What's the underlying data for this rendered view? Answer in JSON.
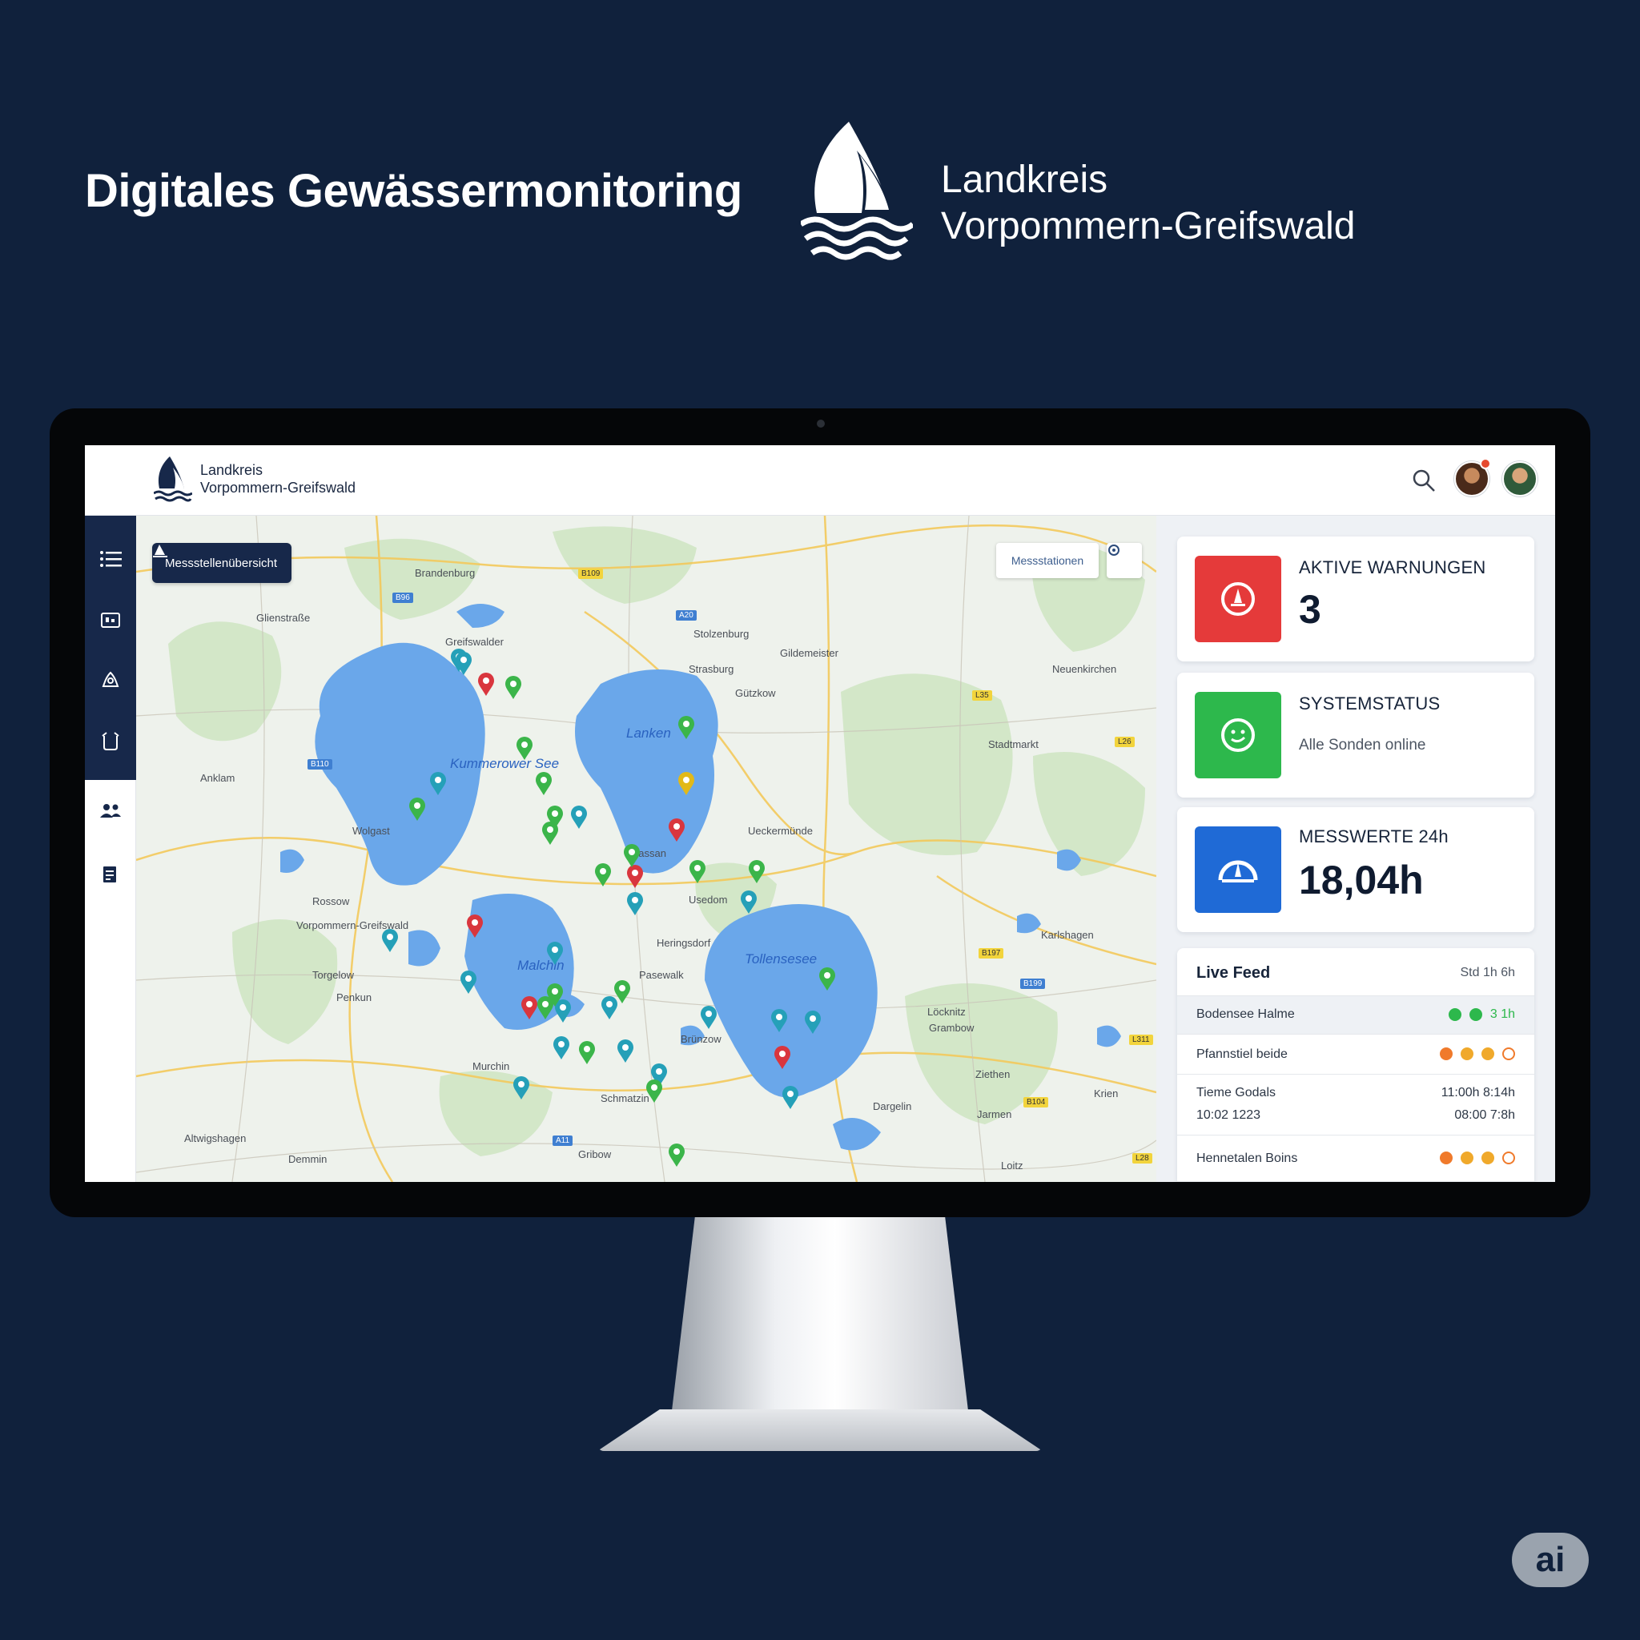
{
  "hero": {
    "title": "Digitales Gewässermonitoring",
    "org_line1": "Landkreis",
    "org_line2": "Vorpommern-Greifswald"
  },
  "app": {
    "header": {
      "org_line1": "Landkreis",
      "org_line2": "Vorpommern-Greifswald",
      "search_icon": "search-icon"
    },
    "sidebar": {
      "items": [
        {
          "icon": "list-icon"
        },
        {
          "icon": "report-icon"
        },
        {
          "icon": "alert-icon"
        },
        {
          "icon": "device-icon"
        },
        {
          "icon": "users-icon"
        },
        {
          "icon": "document-icon"
        }
      ]
    },
    "map": {
      "layer_button": "Messstellenübersicht",
      "ctrl_label": "Messstationen",
      "places": [
        "Brandenburg",
        "Glienstraße",
        "Greifswalder",
        "Stolzenburg",
        "Strasburg",
        "Gildemeister",
        "Neuenkirchen",
        "Gützkow",
        "Stadtmarkt",
        "Anklam",
        "Wolgast",
        "Ueckermünde",
        "Lassan",
        "Vorpommern-Greifswald",
        "Rossow",
        "Usedom",
        "Karlshagen",
        "Heringsdorf",
        "Pasewalk",
        "Torgelow",
        "Penkun",
        "Löcknitz",
        "Grambow",
        "Brünzow",
        "Murchin",
        "Ziethen",
        "Schmatzin",
        "Krien",
        "Altwigshagen",
        "Demmin",
        "Jarmen",
        "Loitz",
        "Gribow",
        "Dargelin"
      ],
      "lakes": [
        "Kummerower See",
        "Lanken",
        "Malchin",
        "Tollensesee"
      ],
      "road_badges": [
        "B109",
        "A20",
        "B96",
        "L35",
        "L26",
        "B110",
        "B197",
        "B199",
        "L311",
        "A11",
        "B104",
        "L28"
      ],
      "marker_colors": {
        "green": "#3bb54a",
        "teal": "#25a0b8",
        "red": "#d9363e",
        "yellow": "#e2b918"
      }
    },
    "cards": {
      "warnings": {
        "title": "AKTIVE WARNUNGEN",
        "value": "3",
        "color": "#e53a3a",
        "icon": "warning-icon"
      },
      "status": {
        "title": "SYSTEMSTATUS",
        "sub": "Alle Sonden online",
        "color": "#2db84c",
        "icon": "status-icon"
      },
      "measurements": {
        "title": "MESSWERTE 24h",
        "value": "18,04h",
        "color": "#1f6ad6",
        "icon": "gauge-icon"
      }
    },
    "feed": {
      "title": "Live Feed",
      "range": "Std 1h 6h",
      "rows": [
        {
          "name": "Bodensee Halme",
          "right": "3 1h",
          "dots": [
            "#2db84c",
            "#2db84c"
          ]
        },
        {
          "name": "Pfannstiel beide",
          "right": "",
          "dots": [
            "#f07a2b",
            "#f0a92b",
            "#f0a92b",
            "#f07a2b"
          ]
        },
        {
          "name": "Tieme Godals",
          "name2": "10:02 1223",
          "right": "11:00h 8:14h",
          "right2": "08:00 7:8h",
          "dots": []
        },
        {
          "name": "Hennetalen Boins",
          "right": "",
          "dots": [
            "#f07a2b",
            "#f0a92b",
            "#f0a92b",
            "#f07a2b"
          ]
        }
      ]
    }
  }
}
